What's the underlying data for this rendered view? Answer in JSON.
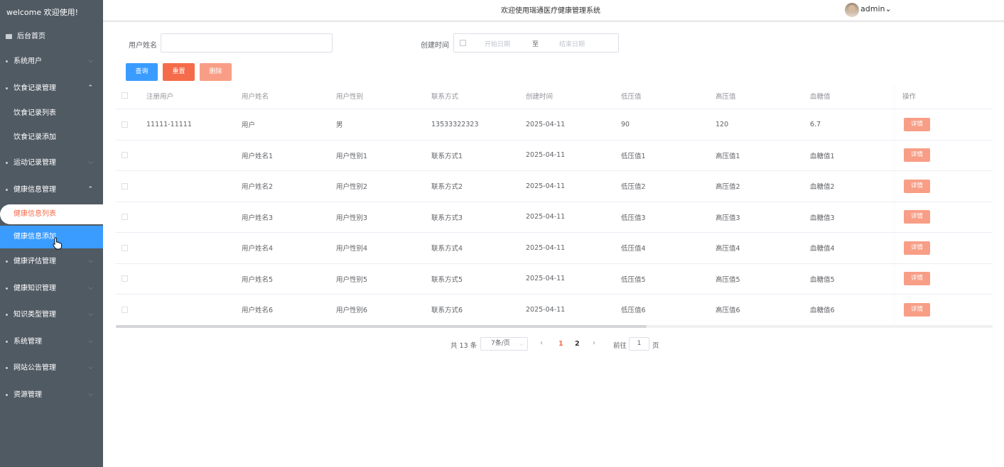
{
  "sidebar": {
    "welcome": "welcome 欢迎使用!",
    "home": "后台首页",
    "menus": [
      {
        "label": "系统用户",
        "expanded": false
      },
      {
        "label": "饮食记录管理",
        "expanded": true,
        "children": [
          "饮食记录列表",
          "饮食记录添加"
        ]
      },
      {
        "label": "运动记录管理",
        "expanded": false
      },
      {
        "label": "健康信息管理",
        "expanded": true,
        "children": [
          "健康信息列表",
          "健康信息添加"
        ]
      },
      {
        "label": "健康评估管理",
        "expanded": false
      },
      {
        "label": "健康知识管理",
        "expanded": false
      },
      {
        "label": "知识类型管理",
        "expanded": false
      },
      {
        "label": "系统管理",
        "expanded": false
      },
      {
        "label": "网站公告管理",
        "expanded": false
      },
      {
        "label": "资源管理",
        "expanded": false
      }
    ],
    "active_item": "健康信息列表",
    "hover_item": "健康信息添加"
  },
  "header": {
    "title": "欢迎使用瑞通医疗健康管理系统",
    "user": "admin"
  },
  "filters": {
    "username_label": "用户姓名",
    "username_value": "",
    "created_label": "创建时间",
    "start_placeholder": "开始日期",
    "range_sep": "至",
    "end_placeholder": "结束日期"
  },
  "buttons": {
    "query": "查询",
    "reset": "重置",
    "delete": "删除"
  },
  "table": {
    "columns": [
      "注册用户",
      "用户姓名",
      "用户性别",
      "联系方式",
      "创建时间",
      "低压值",
      "高压值",
      "血糖值",
      "操作"
    ],
    "detail_label": "详情",
    "rows": [
      [
        "11111-11111",
        "用户",
        "男",
        "13533322323",
        "2025-04-11",
        "90",
        "120",
        "6.7"
      ],
      [
        "",
        "用户姓名1",
        "用户性别1",
        "联系方式1",
        "2025-04-11",
        "低压值1",
        "高压值1",
        "血糖值1"
      ],
      [
        "",
        "用户姓名2",
        "用户性别2",
        "联系方式2",
        "2025-04-11",
        "低压值2",
        "高压值2",
        "血糖值2"
      ],
      [
        "",
        "用户姓名3",
        "用户性别3",
        "联系方式3",
        "2025-04-11",
        "低压值3",
        "高压值3",
        "血糖值3"
      ],
      [
        "",
        "用户姓名4",
        "用户性别4",
        "联系方式4",
        "2025-04-11",
        "低压值4",
        "高压值4",
        "血糖值4"
      ],
      [
        "",
        "用户姓名5",
        "用户性别5",
        "联系方式5",
        "2025-04-11",
        "低压值5",
        "高压值5",
        "血糖值5"
      ],
      [
        "",
        "用户姓名6",
        "用户性别6",
        "联系方式6",
        "2025-04-11",
        "低压值6",
        "高压值6",
        "血糖值6"
      ]
    ]
  },
  "pagination": {
    "total": "共 13 条",
    "page_size": "7条/页",
    "pages": [
      "1",
      "2"
    ],
    "current": "1",
    "goto_label": "前往",
    "goto_value": "1",
    "page_suffix": "页"
  },
  "colors": {
    "sidebar_bg": "#505a63",
    "primary": "#3a9cff",
    "danger": "#f56c4a",
    "danger_light": "#f89e86"
  }
}
